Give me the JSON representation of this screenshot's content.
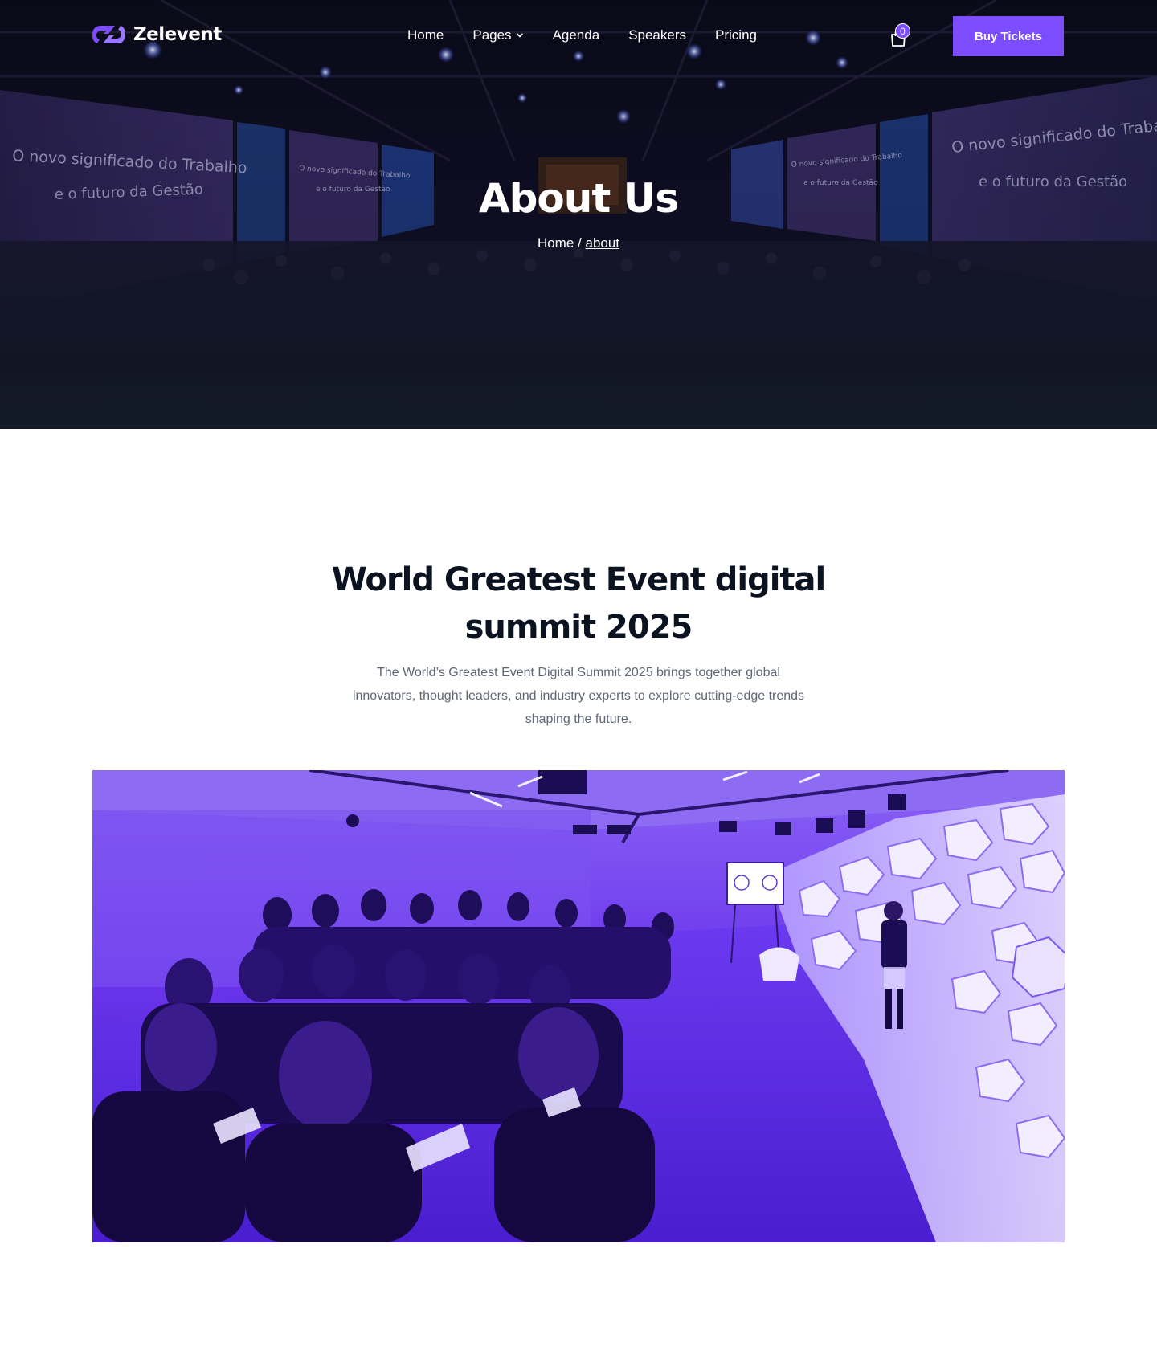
{
  "brand": {
    "name": "Zelevent",
    "accent": "#7c4dff"
  },
  "nav": {
    "items": [
      {
        "label": "Home"
      },
      {
        "label": "Pages",
        "has_dropdown": true
      },
      {
        "label": "Agenda"
      },
      {
        "label": "Speakers"
      },
      {
        "label": "Pricing"
      }
    ],
    "cart_icon": "shopping-bag-icon",
    "cart_count": "0",
    "cta_label": "Buy Tickets"
  },
  "hero": {
    "title": "About Us",
    "breadcrumb": {
      "home": "Home",
      "separator": " / ",
      "current": "about"
    }
  },
  "about": {
    "title": "World Greatest Event digital summit 2025",
    "description": "The World’s Greatest Event Digital Summit 2025 brings together global innovators, thought leaders, and industry experts to explore cutting-edge trends shaping the future."
  }
}
